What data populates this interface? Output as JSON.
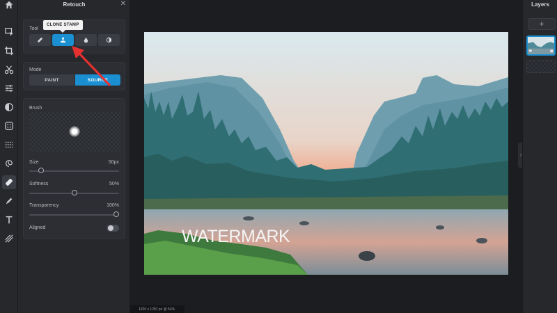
{
  "panel": {
    "title": "Retouch",
    "close_label": "✕",
    "tool": {
      "label": "Tool",
      "tooltip": "CLONE STAMP",
      "buttons": [
        {
          "name": "heal",
          "icon": "bandage-icon"
        },
        {
          "name": "clone-stamp",
          "icon": "stamp-icon",
          "active": true
        },
        {
          "name": "blur",
          "icon": "drop-icon"
        },
        {
          "name": "dodge-burn",
          "icon": "contrast-icon"
        }
      ]
    },
    "mode": {
      "label": "Mode",
      "options": [
        "PAINT",
        "SOURCE"
      ],
      "selected": "SOURCE"
    },
    "brush": {
      "label": "Brush",
      "size_label": "Size",
      "size_value": "50px",
      "size_fraction": 0.12,
      "softness_label": "Softness",
      "softness_value": "50%",
      "softness_fraction": 0.5,
      "transparency_label": "Transparency",
      "transparency_value": "100%",
      "transparency_fraction": 1.0,
      "aligned_label": "Aligned",
      "aligned_on": false
    }
  },
  "canvas": {
    "watermark": "WATERMARK",
    "status": "1920 x 1281 px @ 54%"
  },
  "layers": {
    "title": "Layers",
    "add_label": "+"
  },
  "colors": {
    "accent": "#1a8fd1",
    "panel": "#26282c",
    "arrow": "#e5312f"
  },
  "toolbar_icons": [
    "home-icon",
    "select-icon",
    "crop-icon",
    "cut-icon",
    "adjust-icon",
    "filter-icon",
    "effects-icon",
    "frames-icon",
    "liquify-icon",
    "retouch-icon",
    "draw-icon",
    "text-icon",
    "texture-icon"
  ]
}
